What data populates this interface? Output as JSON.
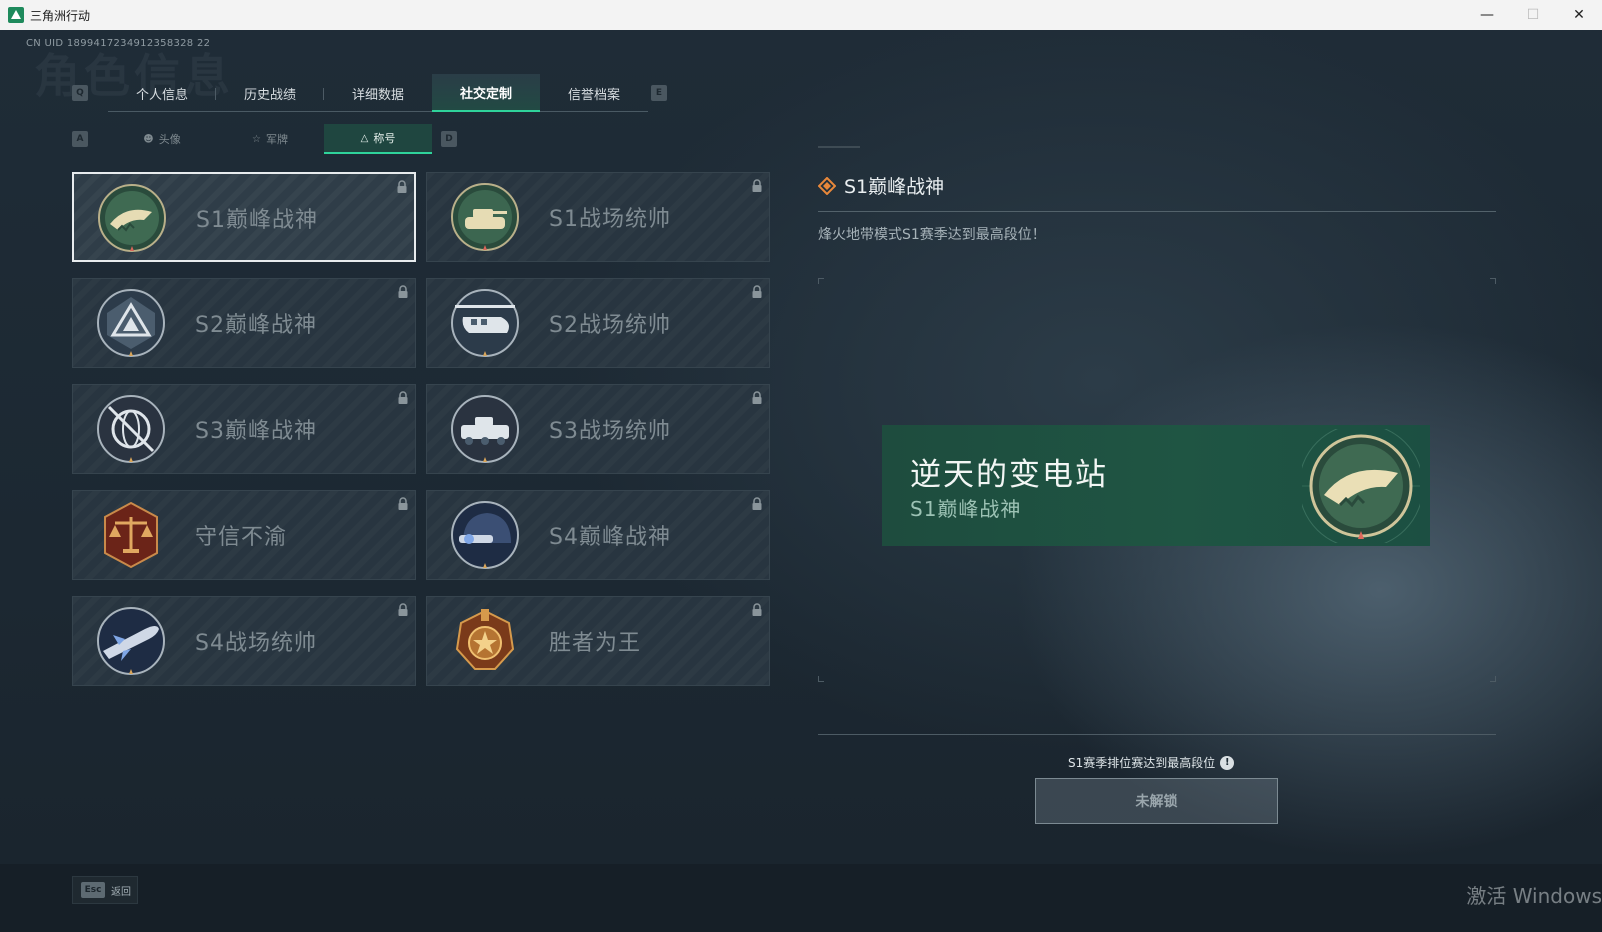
{
  "window": {
    "title": "三角洲行动",
    "controls": {
      "minimize": "—",
      "maximize": "☐",
      "close": "✕"
    }
  },
  "header": {
    "uid": "CN UID 1899417234912358328 22",
    "bg_title": "角色信息"
  },
  "keys": {
    "prev_tab": "Q",
    "next_tab": "E",
    "prev_sub": "A",
    "next_sub": "D"
  },
  "main_tabs": [
    {
      "label": "个人信息",
      "active": false
    },
    {
      "label": "历史战绩",
      "active": false
    },
    {
      "label": "详细数据",
      "active": false
    },
    {
      "label": "社交定制",
      "active": true
    },
    {
      "label": "信誉档案",
      "active": false
    }
  ],
  "sub_tabs": [
    {
      "label": "头像",
      "icon": "person-icon",
      "active": false
    },
    {
      "label": "军牌",
      "icon": "tag-icon",
      "active": false
    },
    {
      "label": "称号",
      "icon": "triangle-icon",
      "active": true
    }
  ],
  "titles": [
    {
      "name": "S1巅峰战神",
      "badge": "crocodile-badge-icon",
      "locked": true,
      "selected": true
    },
    {
      "name": "S1战场统帅",
      "badge": "tank-badge-icon",
      "locked": true,
      "selected": false
    },
    {
      "name": "S2巅峰战神",
      "badge": "pyramid-badge-icon",
      "locked": true,
      "selected": false
    },
    {
      "name": "S2战场统帅",
      "badge": "helicopter-badge-icon",
      "locked": true,
      "selected": false
    },
    {
      "name": "S3巅峰战神",
      "badge": "globe-badge-icon",
      "locked": true,
      "selected": false
    },
    {
      "name": "S3战场统帅",
      "badge": "armored-vehicle-badge-icon",
      "locked": true,
      "selected": false
    },
    {
      "name": "守信不渝",
      "badge": "scales-badge-icon",
      "locked": true,
      "selected": false
    },
    {
      "name": "S4巅峰战神",
      "badge": "helmet-badge-icon",
      "locked": true,
      "selected": false
    },
    {
      "name": "S4战场统帅",
      "badge": "missile-badge-icon",
      "locked": true,
      "selected": false
    },
    {
      "name": "胜者为王",
      "badge": "medal-badge-icon",
      "locked": true,
      "selected": false
    }
  ],
  "detail": {
    "title": "S1巅峰战神",
    "description": "烽火地带模式S1赛季达到最高段位！",
    "preview_name": "逆天的变电站",
    "preview_title": "S1巅峰战神",
    "unlock_condition": "S1赛季排位赛达到最高段位",
    "unlock_info": "!",
    "button_label": "未解锁"
  },
  "footer": {
    "esc_key": "Esc",
    "back_label": "返回"
  },
  "watermark": "激活 Windows",
  "colors": {
    "accent": "#2fd39b",
    "banner": "#1f5543",
    "background": "#1d2a34"
  }
}
